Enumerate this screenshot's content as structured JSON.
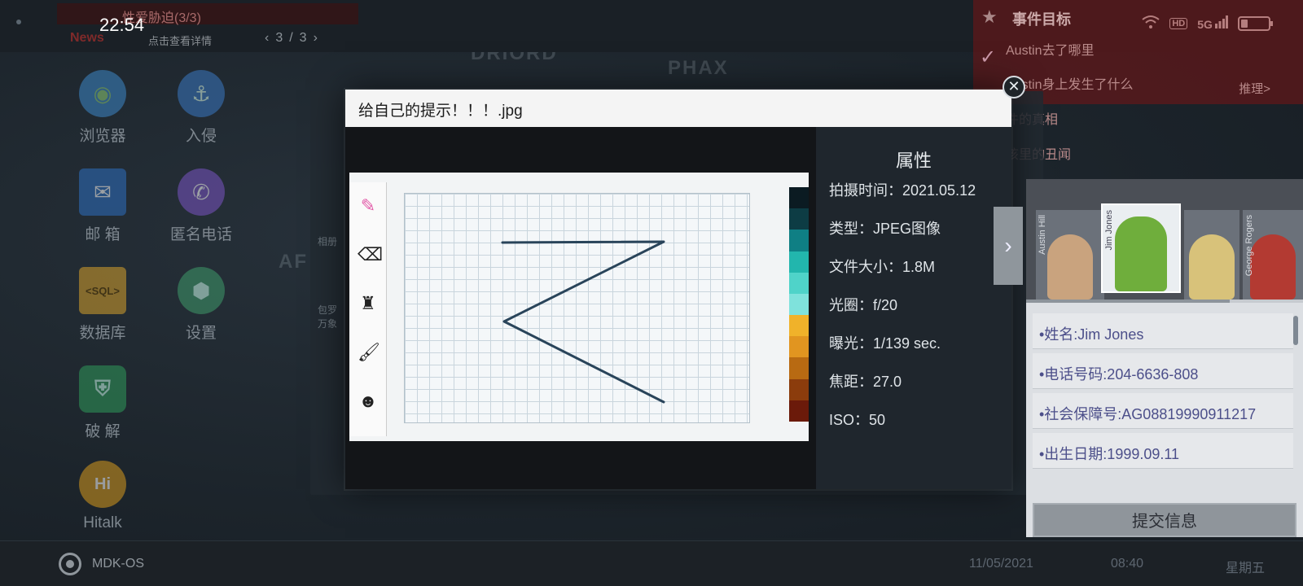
{
  "status_bar": {
    "time": "22:54",
    "network": "5G",
    "hd": "HD"
  },
  "news": {
    "headline": "性爱胁迫(3/3)",
    "badge": "News",
    "more": "点击查看详情",
    "pager": "3/3"
  },
  "map_labels": [
    "DRIORD",
    "PHAX",
    "AF"
  ],
  "event_goals": {
    "title": "事件目标",
    "items": [
      "Austin去了哪里",
      "Austin身上发生了什么",
      "件的真相",
      "该里的丑闻"
    ],
    "more": "推理>"
  },
  "desktop_apps": [
    {
      "label": "浏览器",
      "icon": "globe-icon",
      "color": "#3d87c7"
    },
    {
      "label": "入侵",
      "icon": "hook-icon",
      "color": "#3a78c2"
    },
    {
      "label": "邮  箱",
      "icon": "mail-icon",
      "color": "#2d6fc0"
    },
    {
      "label": "匿名电话",
      "icon": "phone-icon",
      "color": "#7a54c3"
    },
    {
      "label": "数据库",
      "icon": "sql-icon",
      "color": "#d6a12b"
    },
    {
      "label": "设置",
      "icon": "gear-icon",
      "color": "#3f9a6a"
    },
    {
      "label": "破  解",
      "icon": "shield-icon",
      "color": "#2f9a5a"
    },
    {
      "label": "Hitalk",
      "icon": "hitalk-icon",
      "color": "#d79a1d"
    }
  ],
  "background_phone": {
    "labels": [
      "相册",
      "包罗万象"
    ]
  },
  "viewer": {
    "title": "给自己的提示！！！.jpg",
    "props_title": "属性",
    "properties": [
      "拍摄时间：2021.05.12",
      "类型：JPEG图像",
      "文件大小：1.8M",
      "光圈：f/20",
      "曝光：1/139 sec.",
      "焦距：27.0",
      "ISO：50"
    ],
    "tools": [
      "pencil-icon",
      "eraser-icon",
      "stamp-icon",
      "brush-icon",
      "beard-icon"
    ],
    "palette": [
      "#0b1b22",
      "#0d3c44",
      "#0f7f84",
      "#22b6ad",
      "#4fd3c9",
      "#7fe2dc",
      "#f0b22a",
      "#e19520",
      "#b86a12",
      "#8b3c0c",
      "#6b1a0a"
    ]
  },
  "character_card": {
    "portraits": [
      {
        "name": "Austin Hill",
        "face": "#c9a37e"
      },
      {
        "name": "Jim Jones",
        "face": "#6fae3c"
      },
      {
        "name": "",
        "face": "#d8c27a"
      },
      {
        "name": "George Rogers",
        "face": "#b33a32"
      }
    ],
    "fields": [
      "•姓名:Jim Jones",
      "•电话号码:204-6636-808",
      "•社会保障号:AG08819990911217",
      "•出生日期:1999.09.11"
    ],
    "submit": "提交信息"
  },
  "taskbar": {
    "os_name": "MDK-OS",
    "date": "11/05/2021",
    "time": "08:40",
    "weekday": "星期五"
  }
}
